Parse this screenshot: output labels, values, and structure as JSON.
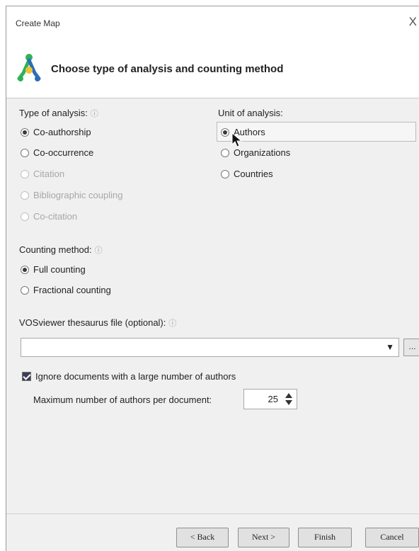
{
  "window": {
    "title": "Create Map",
    "close_glyph": "X"
  },
  "header": {
    "title": "Choose type of analysis and counting method",
    "logo_icon": "vosviewer-logo-icon"
  },
  "type_of_analysis": {
    "label": "Type of analysis:",
    "options": [
      {
        "label": "Co-authorship",
        "selected": true,
        "enabled": true
      },
      {
        "label": "Co-occurrence",
        "selected": false,
        "enabled": true
      },
      {
        "label": "Citation",
        "selected": false,
        "enabled": false
      },
      {
        "label": "Bibliographic coupling",
        "selected": false,
        "enabled": false
      },
      {
        "label": "Co-citation",
        "selected": false,
        "enabled": false
      }
    ]
  },
  "unit_of_analysis": {
    "label": "Unit of analysis:",
    "options": [
      {
        "label": "Authors",
        "selected": true,
        "enabled": true
      },
      {
        "label": "Organizations",
        "selected": false,
        "enabled": true
      },
      {
        "label": "Countries",
        "selected": false,
        "enabled": true
      }
    ]
  },
  "counting_method": {
    "label": "Counting method:",
    "options": [
      {
        "label": "Full counting",
        "selected": true
      },
      {
        "label": "Fractional counting",
        "selected": false
      }
    ]
  },
  "thesaurus": {
    "label": "VOSviewer thesaurus file (optional):",
    "value": "",
    "browse_label": "..."
  },
  "ignore_docs": {
    "label": "Ignore documents with a large number of authors",
    "checked": true,
    "max_label": "Maximum number of authors per document:",
    "max_value": "25"
  },
  "buttons": {
    "back": "< Back",
    "next": "Next >",
    "finish": "Finish",
    "cancel": "Cancel"
  },
  "colors": {
    "background": "#f0f0f0",
    "header_bg": "#ffffff",
    "logo_green": "#2fb15a",
    "logo_blue": "#2c6db7",
    "logo_yellow": "#f1c232"
  }
}
